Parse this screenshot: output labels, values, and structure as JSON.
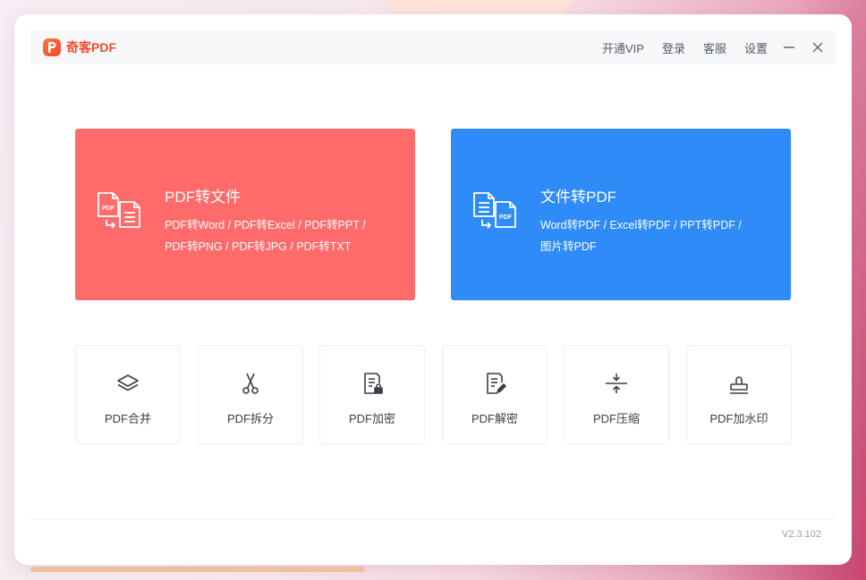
{
  "app": {
    "name": "奇客PDF"
  },
  "top_menu": {
    "vip": "开通VIP",
    "login": "登录",
    "service": "客服",
    "settings": "设置"
  },
  "cards": [
    {
      "title": "PDF转文件",
      "line1": "PDF转Word / PDF转Excel / PDF转PPT /",
      "line2": "PDF转PNG / PDF转JPG / PDF转TXT",
      "color": "#ff6b6b"
    },
    {
      "title": "文件转PDF",
      "line1": "Word转PDF / Excel转PDF / PPT转PDF /",
      "line2": "图片转PDF",
      "color": "#2e8bf7"
    }
  ],
  "tools": [
    {
      "label": "PDF合并",
      "icon": "layers-icon"
    },
    {
      "label": "PDF拆分",
      "icon": "scissors-icon"
    },
    {
      "label": "PDF加密",
      "icon": "lock-document-icon"
    },
    {
      "label": "PDF解密",
      "icon": "edit-document-icon"
    },
    {
      "label": "PDF压缩",
      "icon": "compress-icon"
    },
    {
      "label": "PDF加水印",
      "icon": "stamp-icon"
    }
  ],
  "version": "V2.3.102",
  "colors": {
    "brand": "#f04a2f",
    "red_card": "#ff6b6b",
    "blue_card": "#2e8bf7"
  }
}
